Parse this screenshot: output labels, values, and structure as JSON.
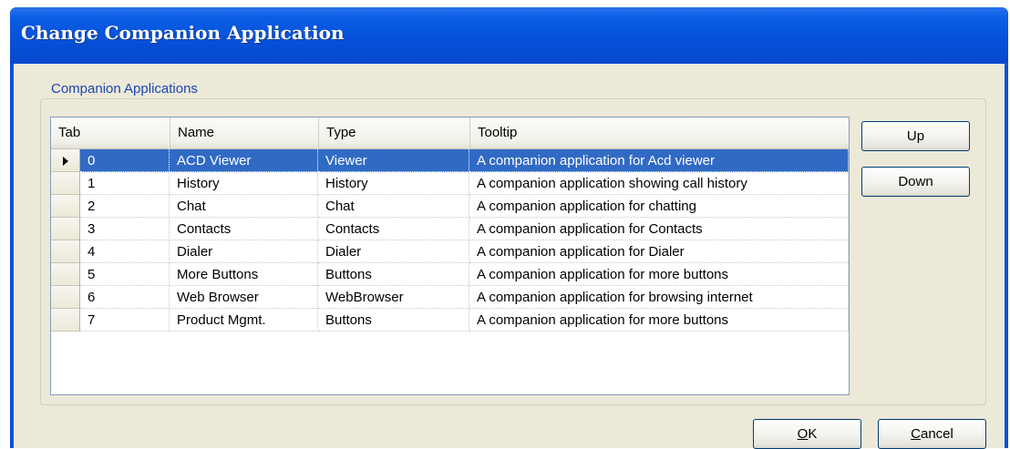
{
  "window": {
    "title": "Change Companion Application"
  },
  "group": {
    "label": "Companion Applications"
  },
  "grid": {
    "columns": [
      "Tab",
      "Name",
      "Type",
      "Tooltip"
    ],
    "rows": [
      {
        "tab": "0",
        "name": "ACD Viewer",
        "type": "Viewer",
        "tooltip": "A companion application for Acd viewer"
      },
      {
        "tab": "1",
        "name": "History",
        "type": "History",
        "tooltip": "A companion application showing call history"
      },
      {
        "tab": "2",
        "name": "Chat",
        "type": "Chat",
        "tooltip": "A companion application for chatting"
      },
      {
        "tab": "3",
        "name": "Contacts",
        "type": "Contacts",
        "tooltip": "A companion application for Contacts"
      },
      {
        "tab": "4",
        "name": "Dialer",
        "type": "Dialer",
        "tooltip": "A companion application for Dialer"
      },
      {
        "tab": "5",
        "name": "More Buttons",
        "type": "Buttons",
        "tooltip": "A companion application for more buttons"
      },
      {
        "tab": "6",
        "name": "Web Browser",
        "type": "WebBrowser",
        "tooltip": "A companion application for browsing internet"
      },
      {
        "tab": "7",
        "name": "Product Mgmt.",
        "type": "Buttons",
        "tooltip": "A companion application for more buttons"
      }
    ],
    "selected_row": 0
  },
  "buttons": {
    "up": "Up",
    "down": "Down",
    "ok_first": "O",
    "ok_rest": "K",
    "cancel_first": "C",
    "cancel_rest": "ancel"
  },
  "colors": {
    "selection": "#316ac5",
    "titlebar": "#0550d8",
    "group_label": "#1c46b4"
  }
}
